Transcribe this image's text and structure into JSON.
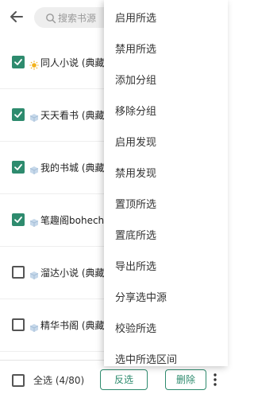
{
  "header": {
    "search_placeholder": "搜索书源"
  },
  "sources": [
    {
      "name": "同人小说 (典藏)",
      "checked": true,
      "icon": "sun-icon"
    },
    {
      "name": "天天看书 (典藏)",
      "checked": true,
      "icon": "cloud-icon"
    },
    {
      "name": "我的书城 (典藏)",
      "checked": true,
      "icon": "cloud-icon"
    },
    {
      "name": "笔趣阁bohecha",
      "checked": true,
      "icon": "cloud-icon"
    },
    {
      "name": "溜达小说 (典藏)",
      "checked": false,
      "icon": "cloud-icon"
    },
    {
      "name": "精华书阁 (典藏)",
      "checked": false,
      "icon": "cloud-icon"
    }
  ],
  "bottom": {
    "select_all_label": "全选",
    "count": "(4/80)",
    "invert_label": "反选",
    "delete_label": "删除"
  },
  "menu": [
    "启用所选",
    "禁用所选",
    "添加分组",
    "移除分组",
    "启用发现",
    "禁用发现",
    "置顶所选",
    "置底所选",
    "导出所选",
    "分享选中源",
    "校验所选",
    "选中所选区间"
  ],
  "colors": {
    "accent": "#2e8b6e"
  }
}
